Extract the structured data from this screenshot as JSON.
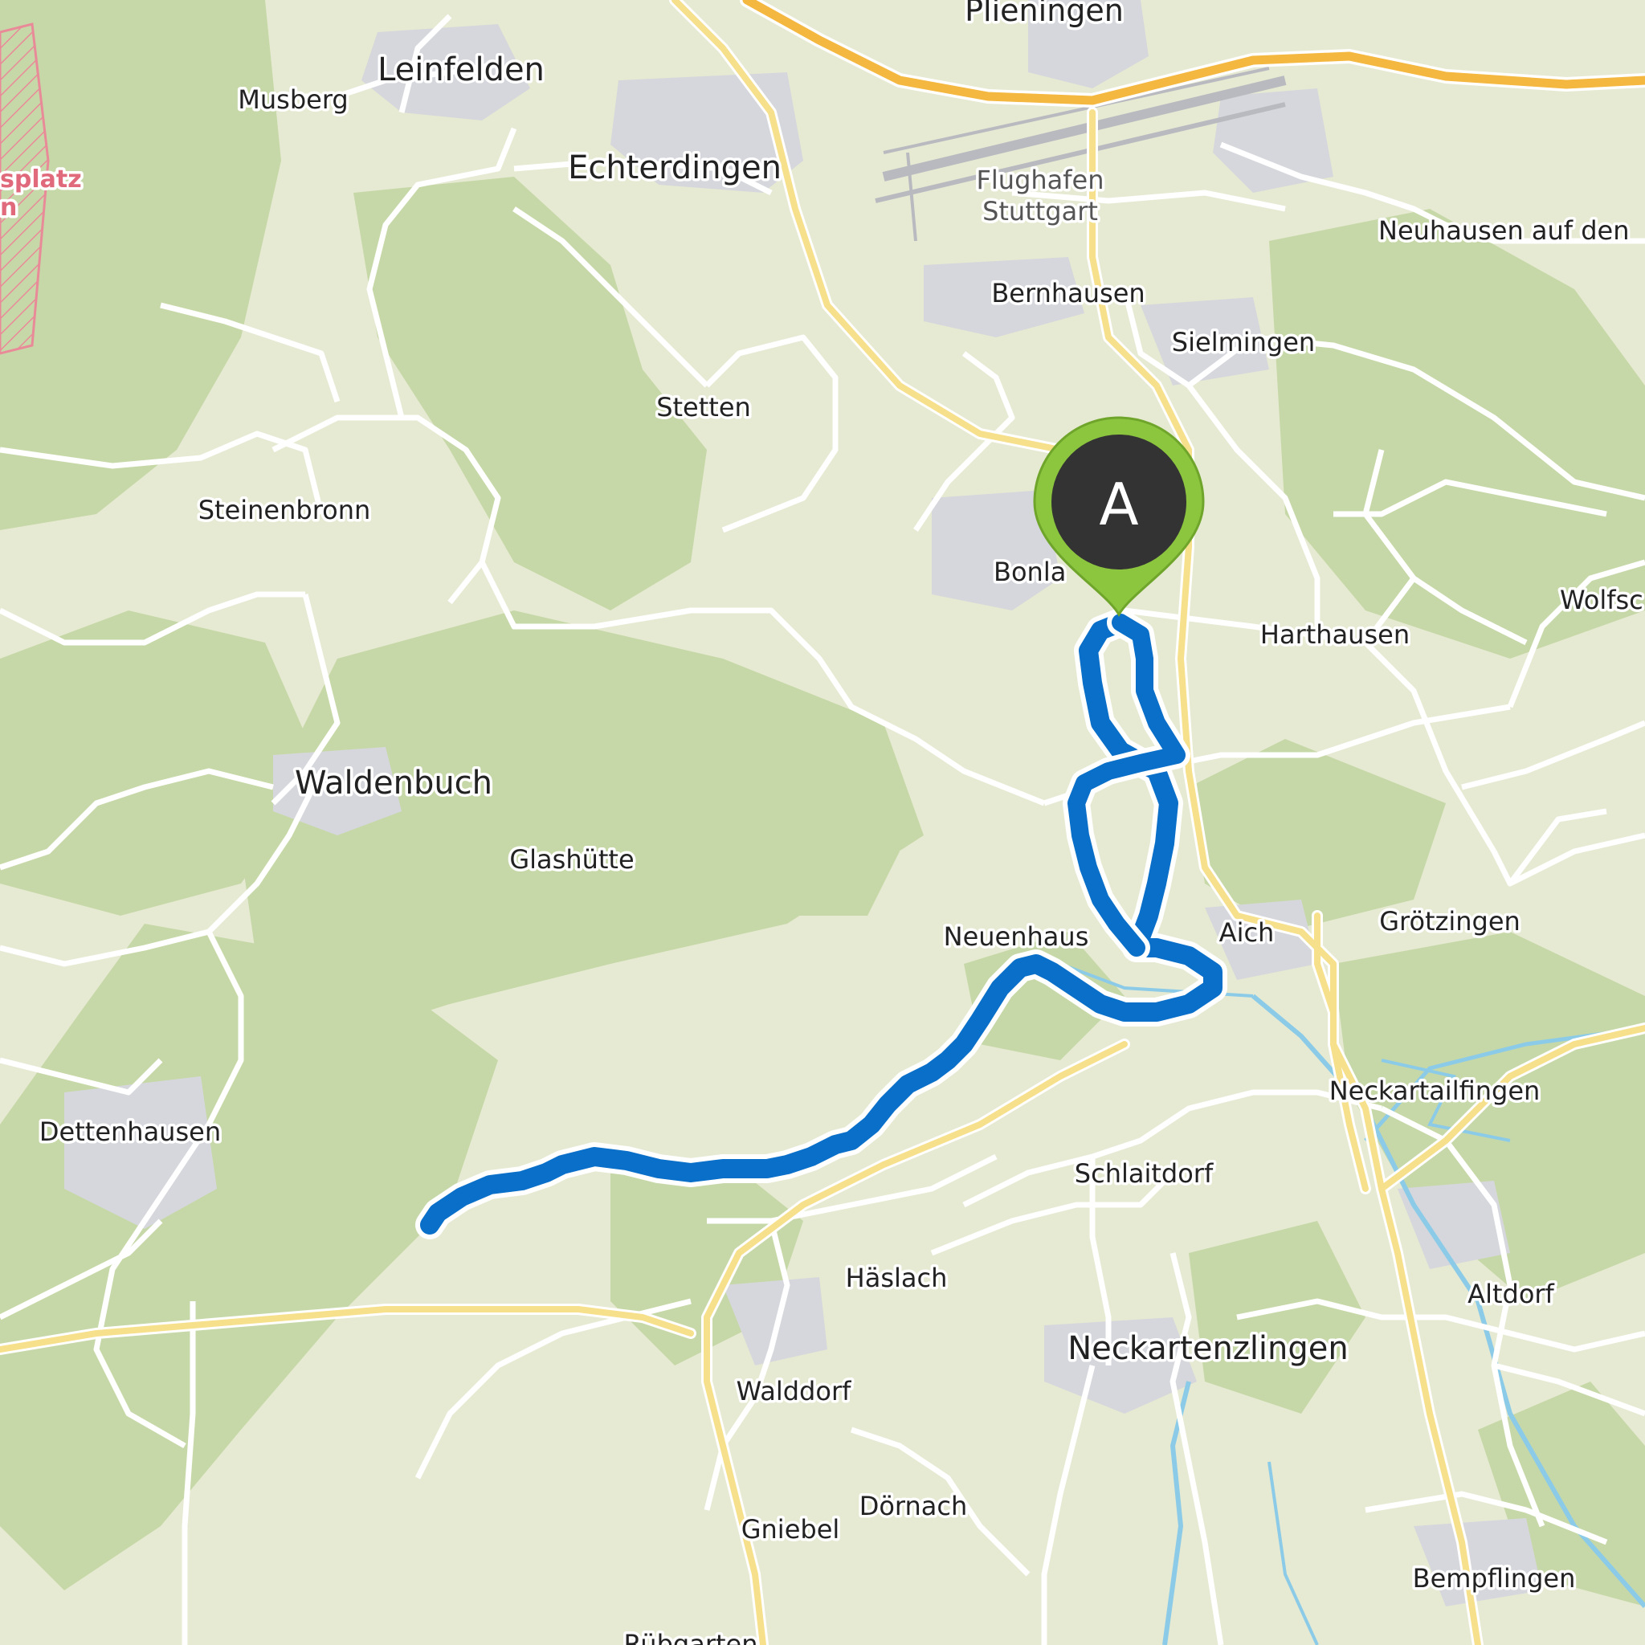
{
  "map": {
    "places": {
      "plieningen": "Plieningen",
      "leinfelden": "Leinfelden",
      "musberg": "Musberg",
      "echterdingen": "Echterdingen",
      "flughafen_line1": "Flughafen",
      "flughafen_line2": "Stuttgart",
      "neuhausen": "Neuhausen auf den",
      "bernhausen": "Bernhausen",
      "sielmingen": "Sielmingen",
      "stetten": "Stetten",
      "steinenbronn": "Steinenbronn",
      "bonlanden": "Bonla",
      "harthausen": "Harthausen",
      "wolfschlugen": "Wolfsc",
      "waldenbuch": "Waldenbuch",
      "glashuette": "Glashütte",
      "neuenhaus": "Neuenhaus",
      "aich": "Aich",
      "groetzingen": "Grötzingen",
      "dettenhausen": "Dettenhausen",
      "neckartailfingen": "Neckartailfingen",
      "schlaitdorf": "Schlaitdorf",
      "haeslach": "Häslach",
      "altdorf": "Altdorf",
      "neckartenzlingen": "Neckartenzlingen",
      "walddorf": "Walddorf",
      "doernach": "Dörnach",
      "gniebel": "Gniebel",
      "bempflingen": "Bempflingen",
      "ruebgarten": "Rübgarten",
      "military_line1": "splatz",
      "military_line2": "n"
    },
    "start_marker": {
      "label": "A",
      "color": "#8cc63f"
    },
    "colors": {
      "route": "#0a6fc9",
      "forest": "#c7d8a8",
      "open_land": "#e6ead2",
      "settlement": "#d6d7dc",
      "highway": "#f4b73f",
      "main_road": "#f6e08c",
      "water": "#8ccbe8",
      "military": "#e98a98"
    }
  }
}
